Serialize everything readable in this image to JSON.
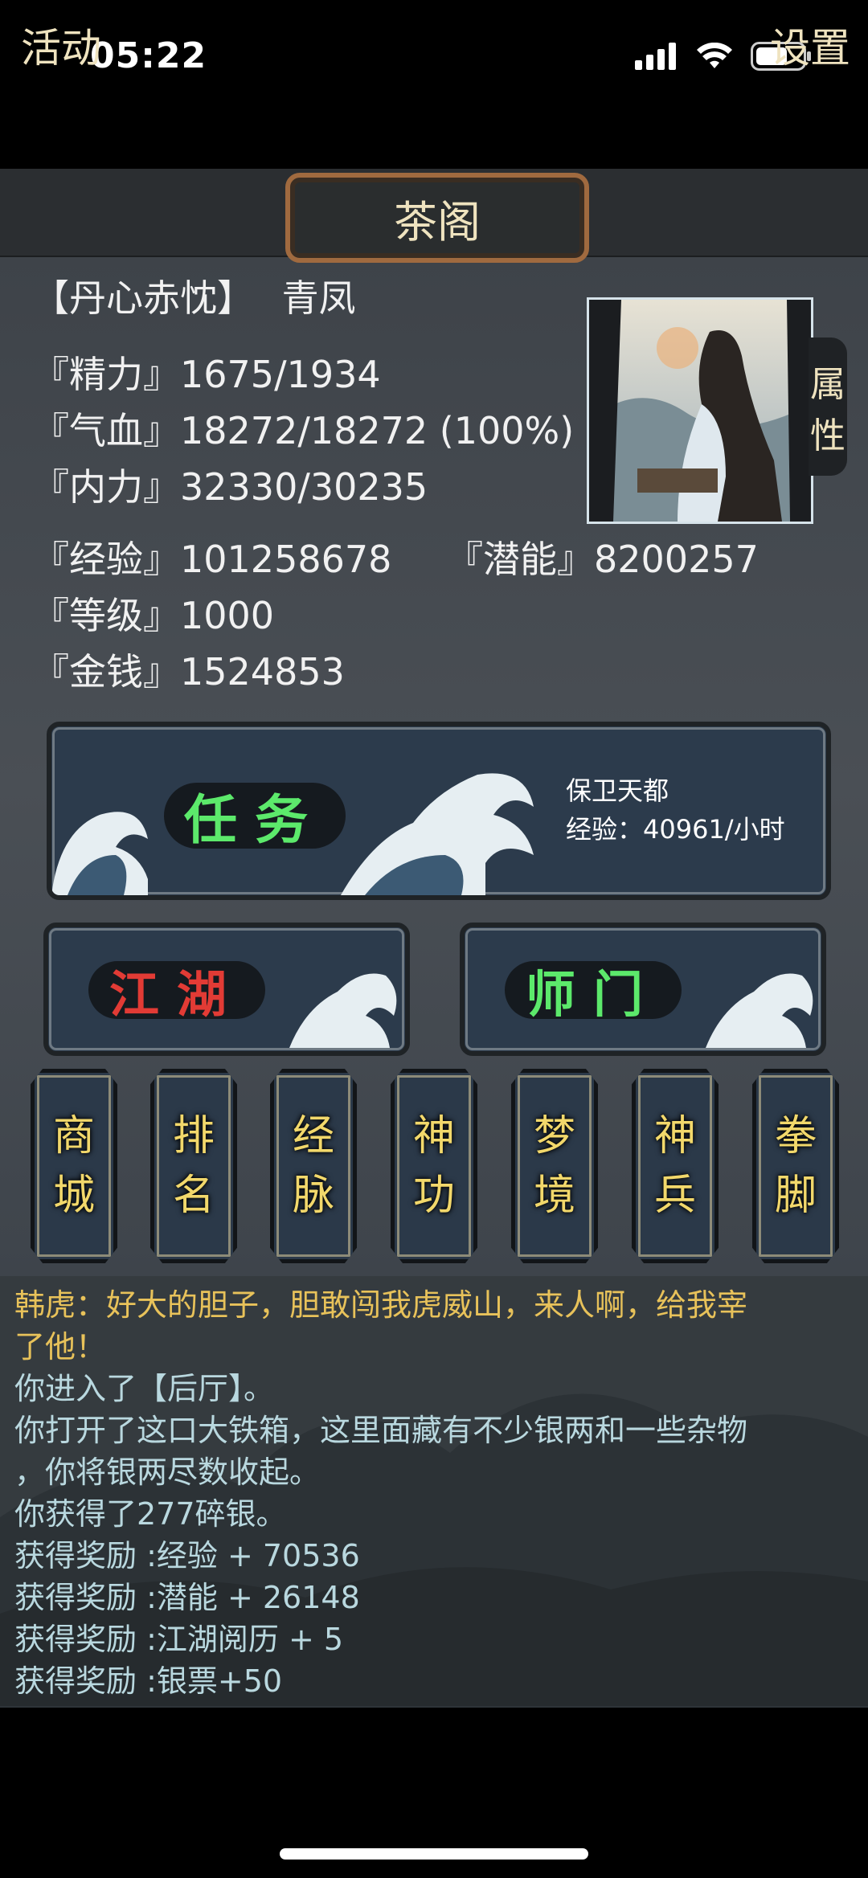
{
  "status_bar": {
    "time": "05:22",
    "battery_level": 0.55
  },
  "topbar": {
    "left": "活动",
    "center": "茶阁",
    "right": "设置"
  },
  "character": {
    "title": "【丹心赤忱】",
    "name": "青凤",
    "attr_tab": [
      "属",
      "性"
    ]
  },
  "stats": {
    "energy": "『精力』1675/1934",
    "hp": "『气血』18272/18272 (100%)",
    "inner": "『内力』32330/30235",
    "exp": "『经验』101258678",
    "potential": "『潜能』8200257",
    "level": "『等级』1000",
    "money": "『金钱』1524853"
  },
  "task_panel": {
    "label": "任务",
    "info_line1": "保卫天都",
    "info_line2": "经验：40961/小时"
  },
  "sub_buttons": {
    "jianghu": "江湖",
    "shimen": "师门"
  },
  "menu": [
    [
      "商",
      "城"
    ],
    [
      "排",
      "名"
    ],
    [
      "经",
      "脉"
    ],
    [
      "神",
      "功"
    ],
    [
      "梦",
      "境"
    ],
    [
      "神",
      "兵"
    ],
    [
      "拳",
      "脚"
    ]
  ],
  "colors": {
    "task_green": "#5ce96b",
    "jianghu_red": "#e23b35",
    "shimen_green": "#5ce96b",
    "menu_gold": "#f2d86b",
    "log_gold": "#e8c25a",
    "log_blue": "#b9d8df"
  },
  "log": [
    "韩虎：好大的胆子，胆敢闯我虎威山，来人啊，给我宰",
    "了他！",
    "你进入了【后厅】。",
    "你打开了这口大铁箱，这里面藏有不少银两和一些杂物",
    "，你将银两尽数收起。",
    "你获得了277碎银。",
    "获得奖励 :经验 + 70536",
    "获得奖励 :潜能 + 26148",
    "获得奖励 :江湖阅历 + 5",
    "获得奖励 :银票+50"
  ]
}
